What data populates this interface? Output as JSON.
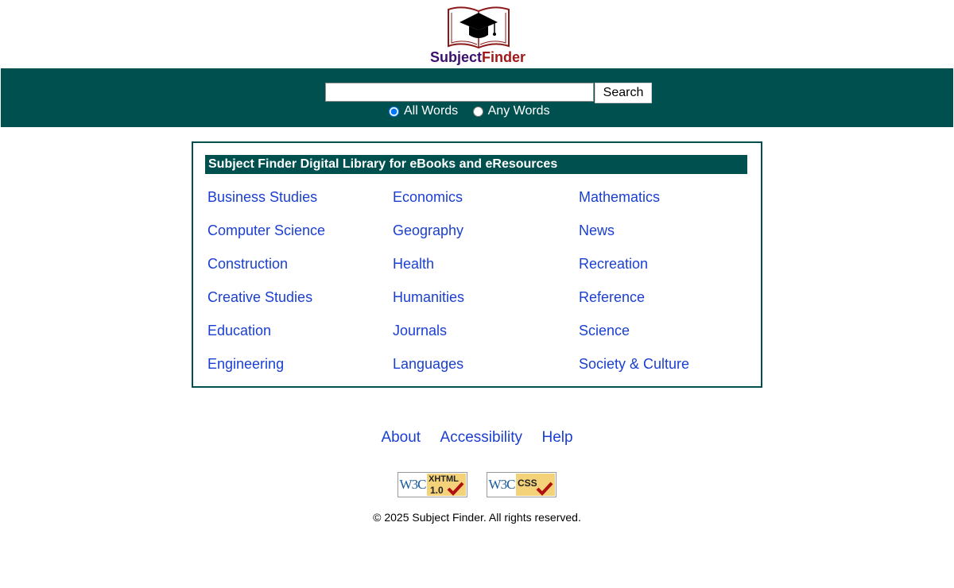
{
  "logo": {
    "part1": "Subject",
    "part2": "Finder"
  },
  "search": {
    "button_label": "Search",
    "value": "",
    "radio_all": "All Words",
    "radio_any": "Any Words",
    "selected": "All Words"
  },
  "panel": {
    "title": "Subject Finder Digital Library for eBooks and eResources",
    "columns": [
      [
        "Business Studies",
        "Computer Science",
        "Construction",
        "Creative Studies",
        "Education",
        "Engineering"
      ],
      [
        "Economics",
        "Geography",
        "Health",
        "Humanities",
        "Journals",
        "Languages"
      ],
      [
        "Mathematics",
        "News",
        "Recreation",
        "Reference",
        "Science",
        "Society & Culture"
      ]
    ]
  },
  "footer": {
    "links": [
      "About",
      "Accessibility",
      "Help"
    ],
    "badges": [
      {
        "w3c": "W3C",
        "label": "XHTML",
        "version": "1.0"
      },
      {
        "w3c": "W3C",
        "label": "CSS",
        "version": ""
      }
    ],
    "copyright": "© 2025 Subject Finder. All rights reserved."
  },
  "colors": {
    "brand": "#005050",
    "link": "#1a3fd1",
    "logo_subject": "#3a0f6e",
    "logo_finder": "#a01818",
    "badge_yellow": "#f3d27a"
  }
}
